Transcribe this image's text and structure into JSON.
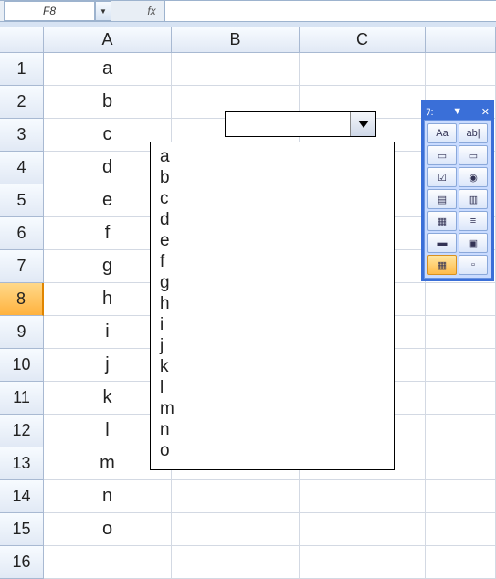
{
  "name_box": {
    "value": "F8"
  },
  "fx_label": "fx",
  "columns": [
    "A",
    "B",
    "C"
  ],
  "rows": [
    {
      "n": "1",
      "A": "a"
    },
    {
      "n": "2",
      "A": "b"
    },
    {
      "n": "3",
      "A": "c"
    },
    {
      "n": "4",
      "A": "d"
    },
    {
      "n": "5",
      "A": "e"
    },
    {
      "n": "6",
      "A": "f"
    },
    {
      "n": "7",
      "A": "g"
    },
    {
      "n": "8",
      "A": "h",
      "selected": true
    },
    {
      "n": "9",
      "A": "i"
    },
    {
      "n": "10",
      "A": "j"
    },
    {
      "n": "11",
      "A": "k"
    },
    {
      "n": "12",
      "A": "l"
    },
    {
      "n": "13",
      "A": "m"
    },
    {
      "n": "14",
      "A": "n"
    },
    {
      "n": "15",
      "A": "o"
    },
    {
      "n": "16",
      "A": ""
    }
  ],
  "combo": {
    "value": ""
  },
  "dropdown_items": [
    "a",
    "b",
    "c",
    "d",
    "e",
    "f",
    "g",
    "h",
    "i",
    "j",
    "k",
    "l",
    "m",
    "n",
    "o"
  ],
  "tool_pane": {
    "title": "ﾌ:",
    "buttons": [
      {
        "name": "label-icon",
        "glyph": "Aa"
      },
      {
        "name": "textbox-icon",
        "glyph": "ab|"
      },
      {
        "name": "group-box-icon",
        "glyph": "▭"
      },
      {
        "name": "button-icon",
        "glyph": "▭"
      },
      {
        "name": "checkbox-icon",
        "glyph": "☑"
      },
      {
        "name": "option-button-icon",
        "glyph": "◉"
      },
      {
        "name": "listbox-icon",
        "glyph": "▤"
      },
      {
        "name": "combobox-icon",
        "glyph": "▥"
      },
      {
        "name": "toggle-icon",
        "glyph": "▦"
      },
      {
        "name": "spin-icon",
        "glyph": "≡"
      },
      {
        "name": "scrollbar-icon",
        "glyph": "▬"
      },
      {
        "name": "image-icon",
        "glyph": "▣"
      },
      {
        "name": "more-controls-icon",
        "glyph": "▦",
        "selected": true
      },
      {
        "name": "properties-icon",
        "glyph": "▫"
      }
    ]
  }
}
